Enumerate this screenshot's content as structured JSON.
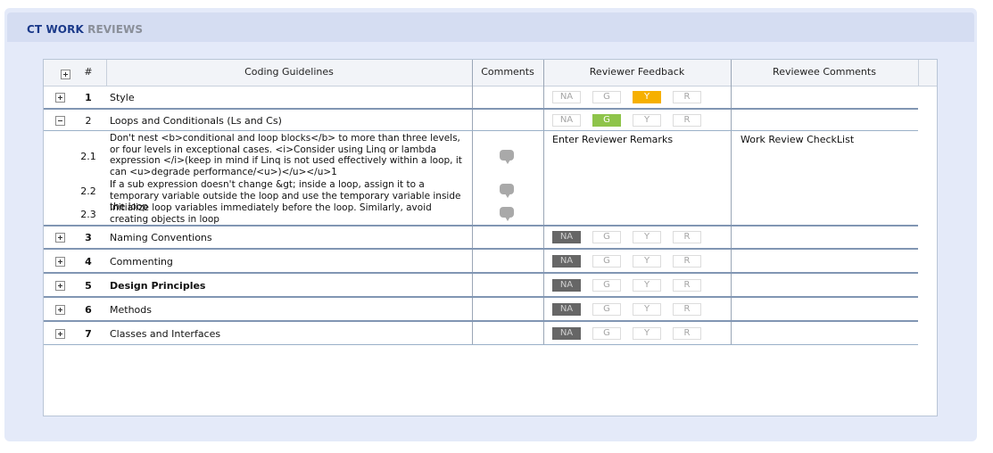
{
  "panel": {
    "title_part1": "CT WORK",
    "title_part2": "REVIEWS"
  },
  "grid": {
    "columns": [
      "#",
      "Coding Guidelines",
      "Comments",
      "Reviewer Feedback",
      "Reviewee Comments"
    ],
    "feedback_options": [
      "NA",
      "G",
      "Y",
      "R"
    ],
    "rows": [
      {
        "num": "1",
        "title": "Style",
        "selected": "Y"
      },
      {
        "num": "2",
        "title": "Loops and Conditionals (Ls and Cs)",
        "selected": "G",
        "expanded": true
      },
      {
        "num": "3",
        "title": "Naming Conventions",
        "selected": "NA"
      },
      {
        "num": "4",
        "title": "Commenting",
        "selected": "NA"
      },
      {
        "num": "5",
        "title": "Design Principles",
        "selected": "NA"
      },
      {
        "num": "6",
        "title": "Methods",
        "selected": "NA"
      },
      {
        "num": "7",
        "title": "Classes and Interfaces",
        "selected": "NA"
      }
    ],
    "subitems": [
      {
        "num": "2.1",
        "text": "Don't nest <b>conditional and loop blocks</b> to more than three levels, or four levels in exceptional cases.  <i>Consider using Linq or lambda expression </i>(keep in mind if Linq is not used effectively within a loop, it can <u>degrade performance/<u>)</u></u>1"
      },
      {
        "num": "2.2",
        "text": "If a sub expression doesn't change &gt; inside a loop, assign it to a temporary variable outside the loop and use the temporary variable inside the loop"
      },
      {
        "num": "2.3",
        "text": "Initialize loop variables immediately before the loop. Similarly, avoid creating objects in loop"
      }
    ],
    "reviewer_remarks": "Enter Reviewer Remarks",
    "reviewee_remarks": "Work Review CheckList"
  }
}
